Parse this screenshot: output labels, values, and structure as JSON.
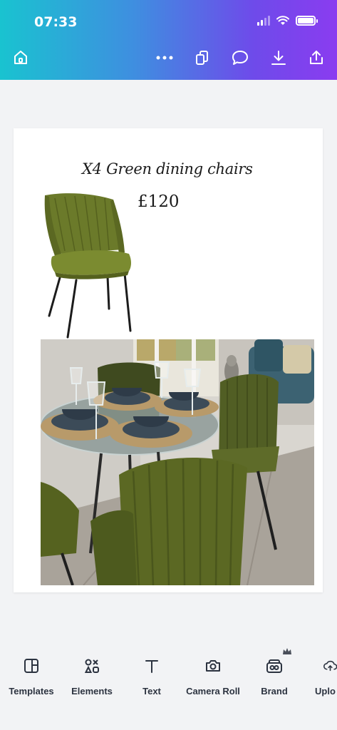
{
  "status": {
    "time": "07:33"
  },
  "toolbar": {
    "icons": [
      "home-icon",
      "more-icon",
      "pages-icon",
      "comment-icon",
      "download-icon",
      "share-icon"
    ]
  },
  "design": {
    "title": "X4 Green dining chairs",
    "price": "£120"
  },
  "bottom_tools": [
    {
      "label": "Templates",
      "icon": "templates-icon"
    },
    {
      "label": "Elements",
      "icon": "elements-icon"
    },
    {
      "label": "Text",
      "icon": "text-icon"
    },
    {
      "label": "Camera Roll",
      "icon": "camera-icon"
    },
    {
      "label": "Brand",
      "icon": "brand-icon"
    },
    {
      "label": "Uplo",
      "icon": "upload-icon"
    }
  ],
  "colors": {
    "header_gradient_start": "#19c3d0",
    "header_gradient_end": "#8a3cf0",
    "chair_green": "#6b7a2a",
    "background": "#f2f3f5"
  }
}
